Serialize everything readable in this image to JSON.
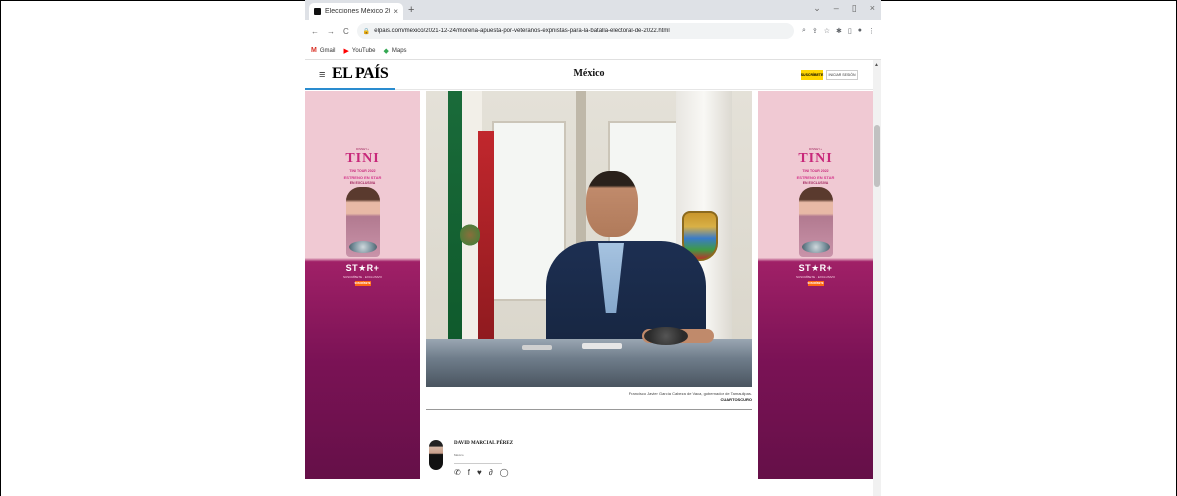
{
  "browser": {
    "tab_title": "Elecciones México 2022: Moren",
    "tab_close": "×",
    "new_tab": "+",
    "window_controls": [
      "⌄",
      "–",
      "▯",
      "×"
    ],
    "nav": {
      "back": "←",
      "forward": "→",
      "reload": "C"
    },
    "url": "elpais.com/mexico/2021-12-24/morena-apuesta-por-veteranos-expriistas-para-la-batalla-electoral-de-2022.html",
    "toolbar_icons": [
      "zoom-icon",
      "share-icon",
      "star-icon",
      "puzzle-icon",
      "sidebar-icon",
      "profile-icon",
      "menu-icon"
    ],
    "bookmarks": [
      {
        "label": "Gmail",
        "icon": "gmail-icon"
      },
      {
        "label": "YouTube",
        "icon": "youtube-icon"
      },
      {
        "label": "Maps",
        "icon": "maps-icon"
      }
    ]
  },
  "site": {
    "logo": "EL PAÍS",
    "section": "México",
    "subscribe_label": "SUSCRÍBETE",
    "login_label": "INICIAR SESIÓN"
  },
  "ad": {
    "small_text": "DISNEY+",
    "headline": "TINI",
    "line1": "TINI TOUR 2022",
    "line2": "ESTRENO EN STAR",
    "line3": "EN EXCLUSIVA",
    "brand": "ST★R+",
    "brand_plus": "+",
    "tag": "SUSCRÍBETE · EXCLUSIVO",
    "cta": "SUSCRÍBETE"
  },
  "article": {
    "caption": "Francisco Javier García Cabeza de Vaca, gobernador de Tamaulipas.",
    "credit": "CUARTOSCURO",
    "author_name": "DAVID MARCIAL PÉREZ",
    "author_meta": "México",
    "share_icons": [
      "whatsapp-icon",
      "facebook-icon",
      "twitter-icon",
      "link-icon",
      "comment-icon"
    ]
  },
  "colors": {
    "accent_blue": "#2a8ccf",
    "subscribe_yellow": "#ffd600",
    "ad_pink": "#f0c9d3",
    "ad_purple": "#7a1255"
  }
}
